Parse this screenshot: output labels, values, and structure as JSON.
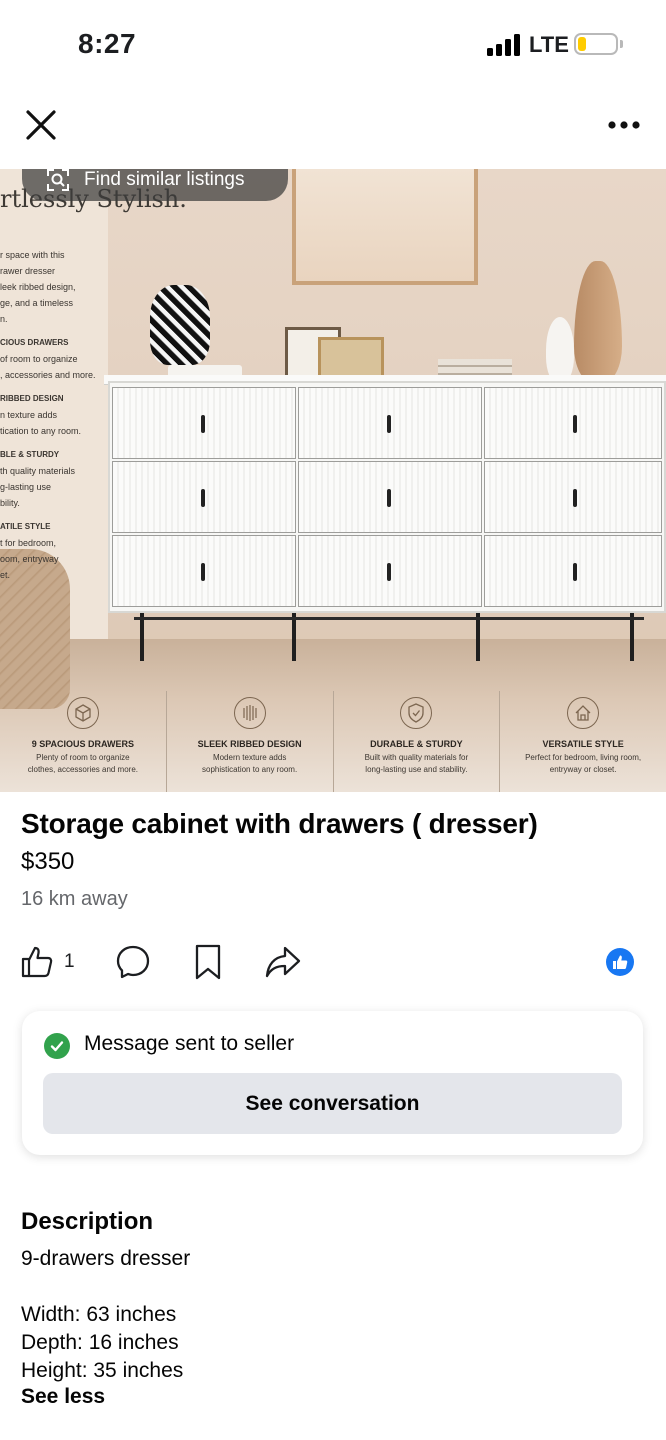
{
  "status_bar": {
    "time": "8:27",
    "network": "LTE",
    "battery_level": 0.15,
    "battery_color": "#ffcc00"
  },
  "nav": {
    "close_icon": "close-icon",
    "more_icon": "more-horizontal-icon"
  },
  "hero": {
    "find_similar_label": "Find similar listings",
    "headline_partial": "rtlessly Stylish.",
    "side_text": [
      "r space with this",
      "rawer dresser",
      "leek ribbed design,",
      "ge, and a timeless",
      "n."
    ],
    "side_features": [
      {
        "title": "CIOUS DRAWERS",
        "lines": [
          "of room to organize",
          ", accessories and more."
        ]
      },
      {
        "title": "RIBBED DESIGN",
        "lines": [
          "n texture adds",
          "tication to any room."
        ]
      },
      {
        "title": "BLE & STURDY",
        "lines": [
          "th quality materials",
          "g-lasting use",
          "bility."
        ]
      },
      {
        "title": "ATILE STYLE",
        "lines": [
          "t for bedroom,",
          "oom, entryway",
          "et."
        ]
      }
    ],
    "features": [
      {
        "icon": "cube-icon",
        "title": "9 SPACIOUS DRAWERS",
        "desc": "Plenty of room to organize clothes, accessories and more."
      },
      {
        "icon": "ribbed-circle-icon",
        "title": "SLEEK RIBBED DESIGN",
        "desc": "Modern texture adds sophistication to any room."
      },
      {
        "icon": "shield-check-icon",
        "title": "DURABLE & STURDY",
        "desc": "Built with quality materials for long-lasting use and stability."
      },
      {
        "icon": "home-icon",
        "title": "VERSATILE STYLE",
        "desc": "Perfect for bedroom, living room, entryway or closet."
      }
    ]
  },
  "listing": {
    "title": "Storage cabinet with drawers ( dresser)",
    "price": "$350",
    "distance": "16 km away"
  },
  "actions": {
    "like_count": "1",
    "icons": [
      "thumbs-up-icon",
      "comment-icon",
      "bookmark-icon",
      "share-icon",
      "facebook-like-badge-icon"
    ],
    "accent_color": "#1877f2"
  },
  "message": {
    "status": "Message sent to seller",
    "button": "See conversation",
    "success_color": "#31a24c"
  },
  "description": {
    "heading": "Description",
    "lines": [
      "9-drawers dresser",
      "",
      "Width: 63 inches",
      "Depth: 16 inches",
      "Height: 35 inches"
    ],
    "toggle": "See less"
  }
}
